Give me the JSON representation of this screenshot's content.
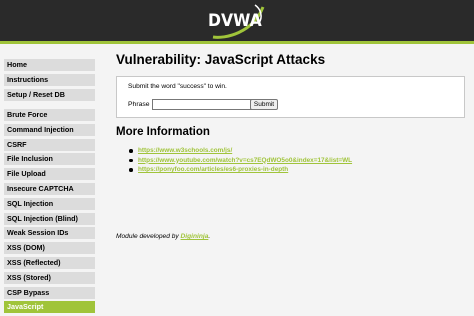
{
  "header": {
    "logo_text": "DVWA",
    "accent_color": "#a0c43a",
    "bar_color": "#2a2a2a"
  },
  "sidebar": {
    "group1": [
      {
        "label": "Home"
      },
      {
        "label": "Instructions"
      },
      {
        "label": "Setup / Reset DB"
      }
    ],
    "group2": [
      {
        "label": "Brute Force"
      },
      {
        "label": "Command Injection"
      },
      {
        "label": "CSRF"
      },
      {
        "label": "File Inclusion"
      },
      {
        "label": "File Upload"
      },
      {
        "label": "Insecure CAPTCHA"
      },
      {
        "label": "SQL Injection"
      },
      {
        "label": "SQL Injection (Blind)"
      },
      {
        "label": "Weak Session IDs"
      },
      {
        "label": "XSS (DOM)"
      },
      {
        "label": "XSS (Reflected)"
      },
      {
        "label": "XSS (Stored)"
      },
      {
        "label": "CSP Bypass"
      },
      {
        "label": "JavaScript",
        "selected": true
      }
    ]
  },
  "main": {
    "title": "Vulnerability: JavaScript Attacks",
    "instruction": "Submit the word \"success\" to win.",
    "phrase_label": "Phrase",
    "phrase_value": "",
    "submit_label": "Submit",
    "more_info_title": "More Information",
    "links": [
      "https://www.w3schools.com/js/",
      "https://www.youtube.com/watch?v=cs7EQdWO5o0&index=17&list=WL",
      "https://ponyfoo.com/articles/es6-proxies-in-depth"
    ],
    "credit_prefix": "Module developed by ",
    "credit_author": "Digininja",
    "credit_suffix": "."
  }
}
